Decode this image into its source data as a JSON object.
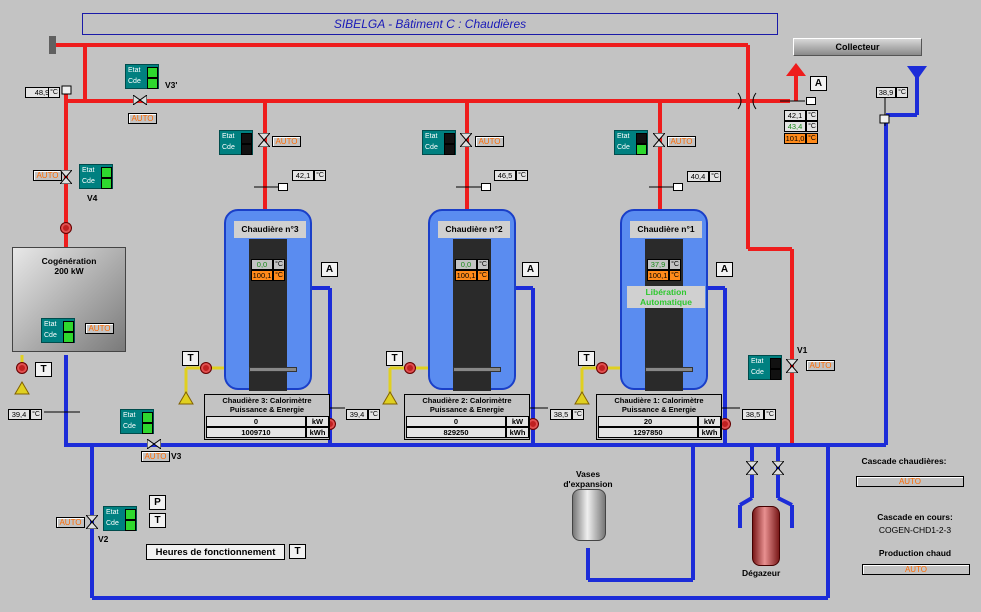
{
  "title": "SIBELGA - Bâtiment C : Chaudières",
  "collecteur": "Collecteur",
  "unit_c": "°C",
  "etat": "Etat",
  "cde": "Cde",
  "auto": "AUTO",
  "btn_a": "A",
  "btn_t": "T",
  "btn_p": "P",
  "supply_temp": "48,9",
  "return_temp_right": "38,9",
  "collector_temps": [
    "42,1",
    "43,4",
    "101,0"
  ],
  "valves": {
    "v3p": "V3'",
    "v4": "V4",
    "v3": "V3",
    "v2": "V2",
    "v1": "V1"
  },
  "cogen": {
    "name": "Cogénération",
    "power": "200 kW",
    "return_temp": "39,4"
  },
  "boilers": [
    {
      "label": "Chaudière n°3",
      "supply_temp": "42,1",
      "temp1": "0,0",
      "temp2": "100,1",
      "return_temp": "39,4",
      "meter_title": "Chaudière 3: Calorimètre",
      "meter_sub": "Puissance & Energie",
      "power": "0",
      "energy": "1009710"
    },
    {
      "label": "Chaudière n°2",
      "supply_temp": "46,5",
      "temp1": "0,0",
      "temp2": "100,1",
      "return_temp": "38,5",
      "meter_title": "Chaudière 2: Calorimètre",
      "meter_sub": "Puissance & Energie",
      "power": "0",
      "energy": "829250"
    },
    {
      "label": "Chaudière n°1",
      "supply_temp": "40,4",
      "temp1": "37,9",
      "temp2": "100,1",
      "return_temp": "38,5",
      "meter_title": "Chaudière 1: Calorimètre",
      "meter_sub": "Puissance & Energie",
      "power": "20",
      "energy": "1297850",
      "liberation": "Libération Automatique"
    }
  ],
  "unit_kw": "kW",
  "unit_kwh": "kWh",
  "heures": "Heures de fonctionnement",
  "vases": "Vases d'expansion",
  "degazeur": "Dégazeur",
  "cascade_label": "Cascade chaudières:",
  "cascade_en_cours_label": "Cascade en cours:",
  "cascade_en_cours": "COGEN-CHD1-2-3",
  "production_label": "Production chaud"
}
